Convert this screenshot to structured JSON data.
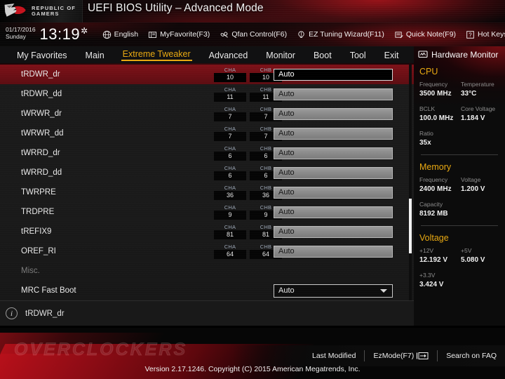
{
  "titlebar": {
    "logo_line1": "REPUBLIC OF",
    "logo_line2": "GAMERS",
    "logo_icon": "rog-eye-logo",
    "title": "UEFI BIOS Utility – Advanced Mode"
  },
  "toolbar": {
    "date": "01/17/2016",
    "weekday": "Sunday",
    "time": "13:19",
    "clock_gear_icon": "gear-icon",
    "items": [
      {
        "label": "English",
        "icon": "globe-icon"
      },
      {
        "label": "MyFavorite(F3)",
        "icon": "book-icon"
      },
      {
        "label": "Qfan Control(F6)",
        "icon": "fan-icon"
      },
      {
        "label": "EZ Tuning Wizard(F11)",
        "icon": "lightbulb-icon"
      },
      {
        "label": "Quick Note(F9)",
        "icon": "note-pencil-icon"
      },
      {
        "label": "Hot Keys",
        "icon": "question-box-icon"
      }
    ]
  },
  "nav": {
    "tabs": [
      {
        "label": "My Favorites",
        "active": false
      },
      {
        "label": "Main",
        "active": false
      },
      {
        "label": "Extreme Tweaker",
        "active": true
      },
      {
        "label": "Advanced",
        "active": false
      },
      {
        "label": "Monitor",
        "active": false
      },
      {
        "label": "Boot",
        "active": false
      },
      {
        "label": "Tool",
        "active": false
      },
      {
        "label": "Exit",
        "active": false
      }
    ],
    "active_color": "#e9a912"
  },
  "settings": {
    "channel_a_label": "CHA",
    "channel_b_label": "CHB",
    "rows": [
      {
        "label": "tRDWR_dr",
        "cha": "10",
        "chb": "10",
        "value": "Auto",
        "type": "field",
        "selected": true
      },
      {
        "label": "tRDWR_dd",
        "cha": "11",
        "chb": "11",
        "value": "Auto",
        "type": "field",
        "selected": false
      },
      {
        "label": "tWRWR_dr",
        "cha": "7",
        "chb": "7",
        "value": "Auto",
        "type": "field",
        "selected": false
      },
      {
        "label": "tWRWR_dd",
        "cha": "7",
        "chb": "7",
        "value": "Auto",
        "type": "field",
        "selected": false
      },
      {
        "label": "tWRRD_dr",
        "cha": "6",
        "chb": "6",
        "value": "Auto",
        "type": "field",
        "selected": false
      },
      {
        "label": "tWRRD_dd",
        "cha": "6",
        "chb": "6",
        "value": "Auto",
        "type": "field",
        "selected": false
      },
      {
        "label": "TWRPRE",
        "cha": "36",
        "chb": "36",
        "value": "Auto",
        "type": "field",
        "selected": false
      },
      {
        "label": "TRDPRE",
        "cha": "9",
        "chb": "9",
        "value": "Auto",
        "type": "field",
        "selected": false
      },
      {
        "label": "tREFIX9",
        "cha": "81",
        "chb": "81",
        "value": "Auto",
        "type": "field",
        "selected": false
      },
      {
        "label": "OREF_RI",
        "cha": "64",
        "chb": "64",
        "value": "Auto",
        "type": "field",
        "selected": false
      },
      {
        "label": "Misc.",
        "cha": "",
        "chb": "",
        "value": "",
        "type": "section",
        "selected": false
      },
      {
        "label": "MRC Fast Boot",
        "cha": "",
        "chb": "",
        "value": "Auto",
        "type": "dropdown",
        "selected": false
      }
    ]
  },
  "help": {
    "icon": "info-icon",
    "text": "tRDWR_dr"
  },
  "hardware_monitor": {
    "title": "Hardware Monitor",
    "title_icon": "monitor-icon",
    "sections": [
      {
        "name": "CPU",
        "pairs": [
          [
            {
              "key": "Frequency",
              "value": "3500 MHz"
            },
            {
              "key": "Temperature",
              "value": "33°C"
            }
          ],
          [
            {
              "key": "BCLK",
              "value": "100.0 MHz"
            },
            {
              "key": "Core Voltage",
              "value": "1.184 V"
            }
          ],
          [
            {
              "key": "Ratio",
              "value": "35x"
            }
          ]
        ]
      },
      {
        "name": "Memory",
        "pairs": [
          [
            {
              "key": "Frequency",
              "value": "2400 MHz"
            },
            {
              "key": "Voltage",
              "value": "1.200 V"
            }
          ],
          [
            {
              "key": "Capacity",
              "value": "8192 MB"
            }
          ]
        ]
      },
      {
        "name": "Voltage",
        "pairs": [
          [
            {
              "key": "+12V",
              "value": "12.192 V"
            },
            {
              "key": "+5V",
              "value": "5.080 V"
            }
          ],
          [
            {
              "key": "+3.3V",
              "value": "3.424 V"
            }
          ]
        ]
      }
    ],
    "accent_color": "#e9a912"
  },
  "footer": {
    "last_modified": "Last Modified",
    "ez_mode": "EzMode(F7)",
    "ez_mode_icon": "arrow-right-bar-icon",
    "search_faq": "Search on FAQ",
    "watermark": "OVERCLOCKERS",
    "version": "Version 2.17.1246. Copyright (C) 2015 American Megatrends, Inc."
  }
}
